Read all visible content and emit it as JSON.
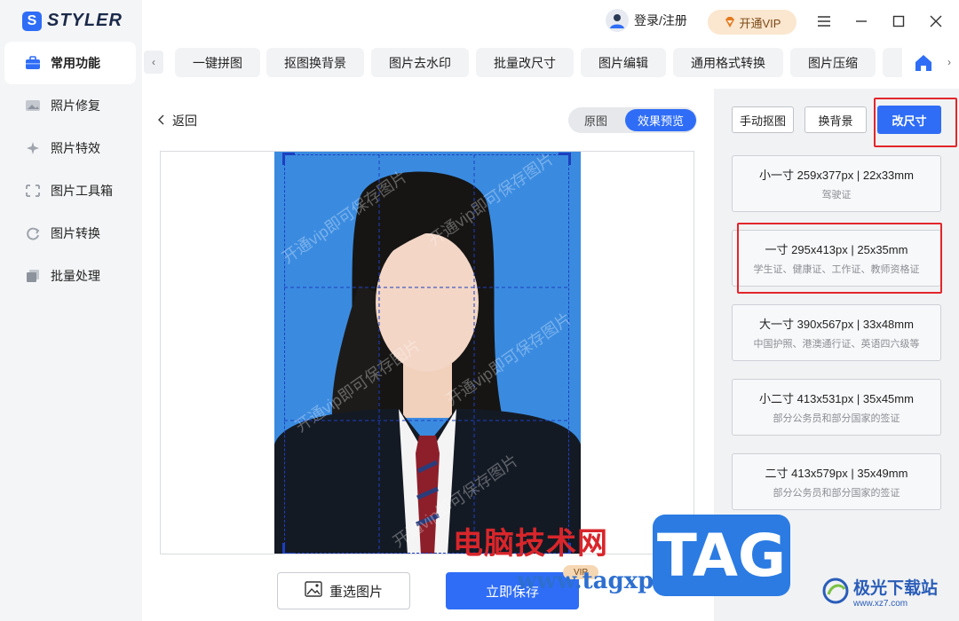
{
  "app": {
    "logo_letter": "S",
    "name": "STYLER"
  },
  "sidebar": {
    "items": [
      {
        "label": "常用功能",
        "icon": "briefcase-icon",
        "active": true
      },
      {
        "label": "照片修复",
        "icon": "photo-repair-icon",
        "active": false
      },
      {
        "label": "照片特效",
        "icon": "sparkle-icon",
        "active": false
      },
      {
        "label": "图片工具箱",
        "icon": "toolbox-icon",
        "active": false
      },
      {
        "label": "图片转换",
        "icon": "convert-icon",
        "active": false
      },
      {
        "label": "批量处理",
        "icon": "batch-icon",
        "active": false
      }
    ]
  },
  "header": {
    "login_label": "登录/注册",
    "vip_label": "开通VIP"
  },
  "toolbar": {
    "tabs": [
      "一键拼图",
      "抠图换背景",
      "图片去水印",
      "批量改尺寸",
      "图片编辑",
      "通用格式转换",
      "图片压缩"
    ]
  },
  "editor": {
    "back_label": "返回",
    "view_original": "原图",
    "view_preview": "效果预览",
    "watermark_text": "开通vip即可保存图片",
    "reselect_label": "重选图片",
    "save_label": "立即保存",
    "save_badge": "VIP"
  },
  "panel": {
    "manual_cutout": "手动抠图",
    "change_bg": "换背景",
    "resize": "改尺寸",
    "sizes": [
      {
        "title": "小一寸 259x377px | 22x33mm",
        "desc": "驾驶证"
      },
      {
        "title": "一寸 295x413px | 25x35mm",
        "desc": "学生证、健康证、工作证、教师资格证"
      },
      {
        "title": "大一寸 390x567px | 33x48mm",
        "desc": "中国护照、港澳通行证、英语四六级等"
      },
      {
        "title": "小二寸 413x531px | 35x45mm",
        "desc": "部分公务员和部分国家的签证"
      },
      {
        "title": "二寸 413x579px | 35x49mm",
        "desc": "部分公务员和部分国家的签证"
      }
    ]
  },
  "overlay": {
    "site_name": "电脑技术网",
    "site_url": "www.tagxp.com",
    "tag": "TAG",
    "xz_name": "极光下载站",
    "xz_url": "www.xz7.com"
  },
  "colors": {
    "accent": "#2f6df6",
    "photo_background": "#3a8be0",
    "highlight_red": "#e2262b"
  }
}
